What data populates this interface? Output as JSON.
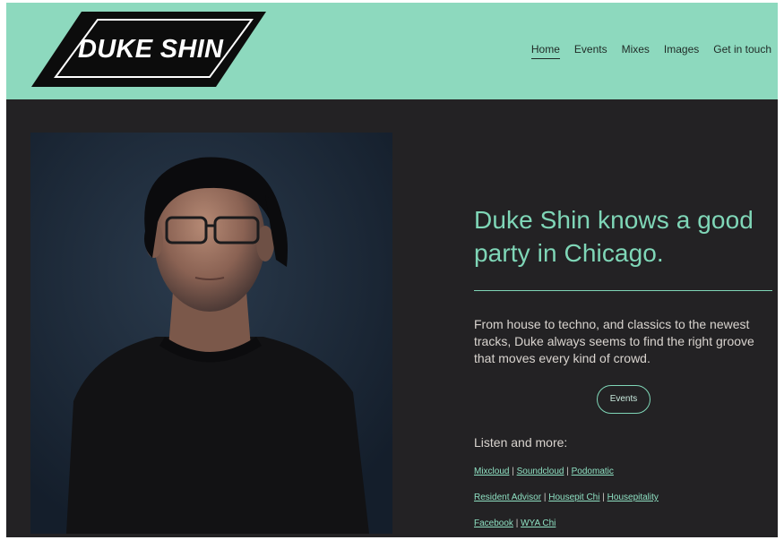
{
  "brand": {
    "logo_text": "DUKE SHIN"
  },
  "nav": [
    {
      "label": "Home",
      "active": true
    },
    {
      "label": "Events"
    },
    {
      "label": "Mixes"
    },
    {
      "label": "Images"
    },
    {
      "label": "Get in touch"
    }
  ],
  "hero": {
    "headline": "Duke Shin knows a good party in Chicago.",
    "intro": "From house to techno, and classics to the newest tracks, Duke always seems to find the right groove that moves every kind of crowd.",
    "events_button": "Events",
    "listen_heading": "Listen and more:"
  },
  "links": {
    "row1": [
      "Mixcloud",
      "Soundcloud",
      "Podomatic"
    ],
    "row2": [
      "Resident Advisor",
      "Housepit Chi",
      "Housepitality"
    ],
    "row3": [
      "Facebook",
      "WYA Chi"
    ],
    "separator": "|"
  },
  "colors": {
    "header_bg": "#8dd9be",
    "page_bg": "#232224",
    "accent": "#7fd6b7"
  }
}
